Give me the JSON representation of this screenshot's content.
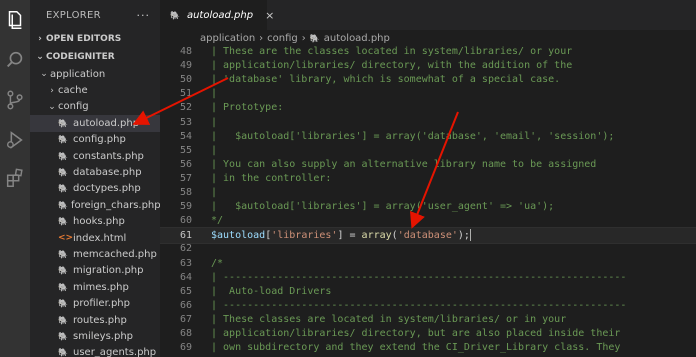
{
  "activity_bar": {
    "icons": [
      "files-icon",
      "search-icon",
      "source-control-icon",
      "run-debug-icon",
      "extensions-icon"
    ]
  },
  "sidebar": {
    "title": "EXPLORER",
    "more": "···",
    "open_editors": "OPEN EDITORS",
    "project": "CODEIGNITER",
    "tree": [
      {
        "label": "application",
        "kind": "folder-open",
        "indent": 1
      },
      {
        "label": "cache",
        "kind": "folder",
        "indent": 2
      },
      {
        "label": "config",
        "kind": "folder-open",
        "indent": 2
      },
      {
        "label": "autoload.php",
        "kind": "php",
        "indent": 3,
        "selected": true
      },
      {
        "label": "config.php",
        "kind": "php",
        "indent": 3
      },
      {
        "label": "constants.php",
        "kind": "php",
        "indent": 3
      },
      {
        "label": "database.php",
        "kind": "php",
        "indent": 3
      },
      {
        "label": "doctypes.php",
        "kind": "php",
        "indent": 3
      },
      {
        "label": "foreign_chars.php",
        "kind": "php",
        "indent": 3
      },
      {
        "label": "hooks.php",
        "kind": "php",
        "indent": 3
      },
      {
        "label": "index.html",
        "kind": "html",
        "indent": 3
      },
      {
        "label": "memcached.php",
        "kind": "php",
        "indent": 3
      },
      {
        "label": "migration.php",
        "kind": "php",
        "indent": 3
      },
      {
        "label": "mimes.php",
        "kind": "php",
        "indent": 3
      },
      {
        "label": "profiler.php",
        "kind": "php",
        "indent": 3
      },
      {
        "label": "routes.php",
        "kind": "php",
        "indent": 3
      },
      {
        "label": "smileys.php",
        "kind": "php",
        "indent": 3
      },
      {
        "label": "user_agents.php",
        "kind": "php",
        "indent": 3
      }
    ]
  },
  "tab": {
    "label": "autoload.php",
    "close": "×"
  },
  "breadcrumb": [
    "application",
    "config",
    "autoload.php"
  ],
  "code_lines": [
    {
      "n": "48",
      "text": "| These are the classes located in system/libraries/ or your"
    },
    {
      "n": "49",
      "text": "| application/libraries/ directory, with the addition of the"
    },
    {
      "n": "50",
      "text": "| 'database' library, which is somewhat of a special case."
    },
    {
      "n": "51",
      "text": "|"
    },
    {
      "n": "52",
      "text": "| Prototype:"
    },
    {
      "n": "53",
      "text": "|"
    },
    {
      "n": "54",
      "text": "|   $autoload['libraries'] = array('database', 'email', 'session');"
    },
    {
      "n": "55",
      "text": "|"
    },
    {
      "n": "56",
      "text": "| You can also supply an alternative library name to be assigned"
    },
    {
      "n": "57",
      "text": "| in the controller:"
    },
    {
      "n": "58",
      "text": "|"
    },
    {
      "n": "59",
      "text": "|   $autoload['libraries'] = array('user_agent' => 'ua');"
    },
    {
      "n": "60",
      "text": "*/"
    },
    {
      "n": "61",
      "text": "",
      "current": true
    },
    {
      "n": "62",
      "text": ""
    },
    {
      "n": "63",
      "text": "/*"
    },
    {
      "n": "64",
      "text": "| -------------------------------------------------------------------"
    },
    {
      "n": "65",
      "text": "|  Auto-load Drivers"
    },
    {
      "n": "66",
      "text": "| -------------------------------------------------------------------"
    },
    {
      "n": "67",
      "text": "| These classes are located in system/libraries/ or in your"
    },
    {
      "n": "68",
      "text": "| application/libraries/ directory, but are also placed inside their"
    },
    {
      "n": "69",
      "text": "| own subdirectory and they extend the CI_Driver_Library class. They"
    }
  ],
  "line61": {
    "var": "$autoload",
    "open_bracket": "[",
    "key": "'libraries'",
    "close_bracket": "]",
    "assign": " = ",
    "fn": "array",
    "open_paren": "(",
    "arg": "'database'",
    "close": ");"
  },
  "colors": {
    "comment": "#6a9955",
    "variable": "#9cdcfe",
    "string": "#ce9178",
    "function": "#dcdcaa",
    "arrow": "#e51400"
  }
}
